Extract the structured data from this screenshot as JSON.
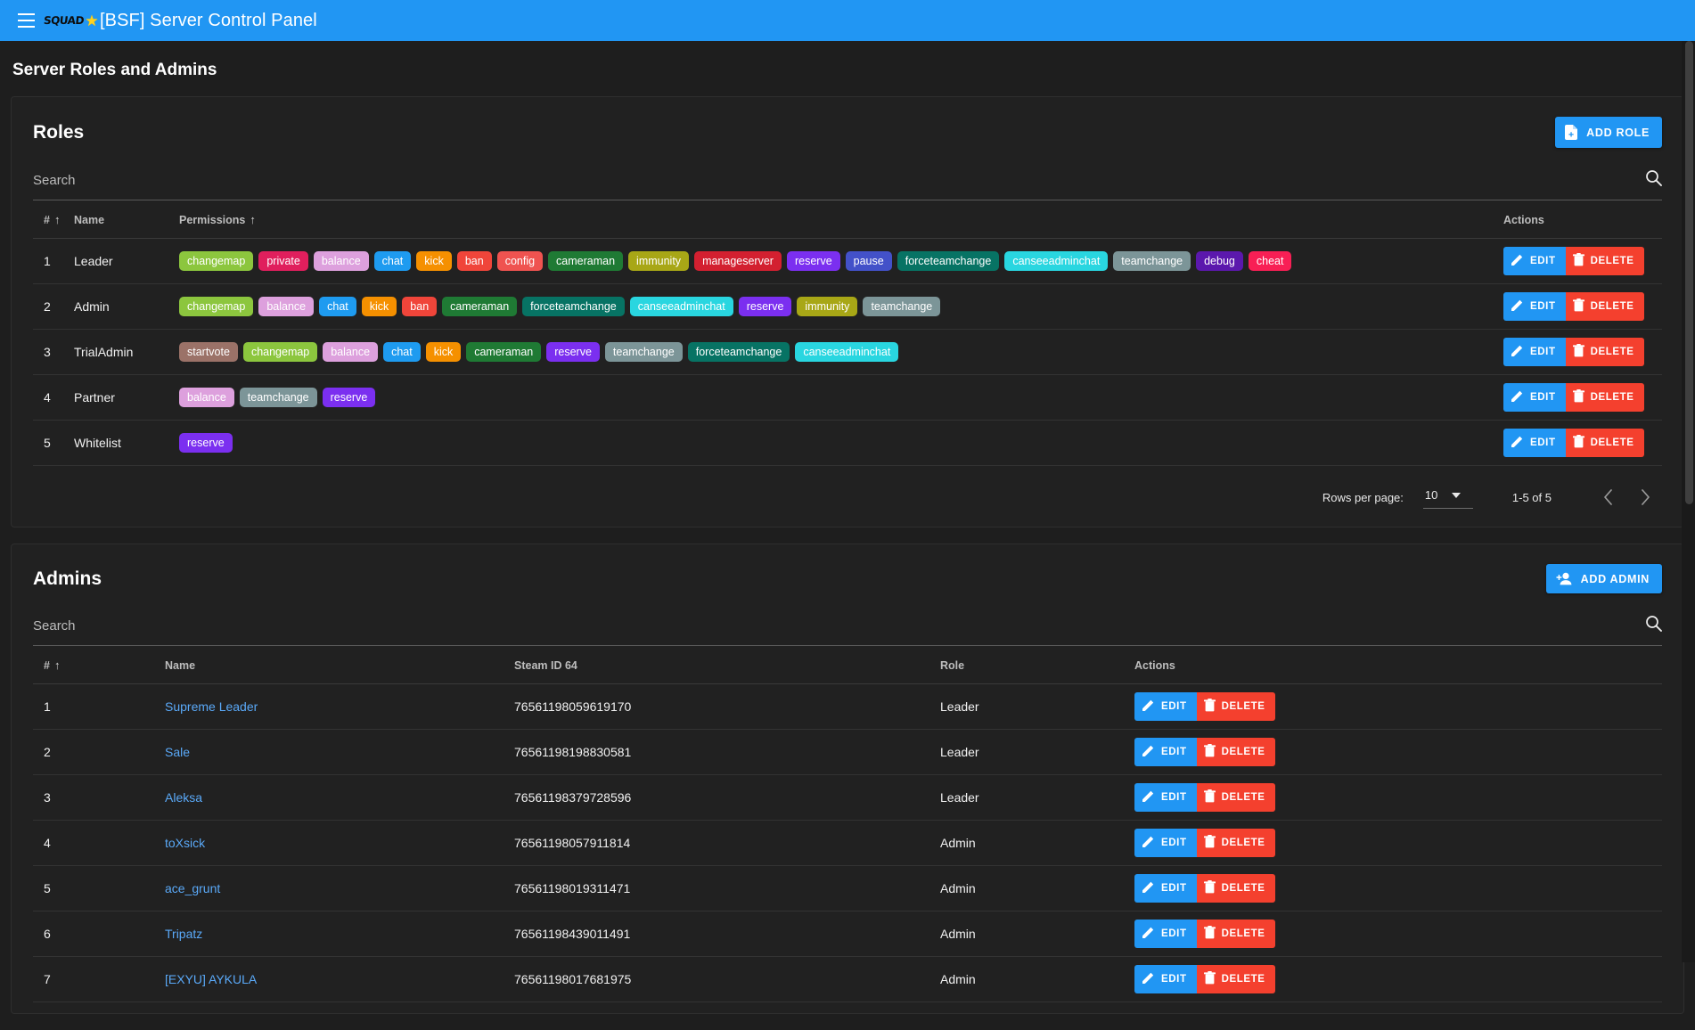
{
  "appbar": {
    "menu_icon": "hamburger-menu-icon",
    "logo_text": "SQUAD",
    "logo_star": "★",
    "title": "[BSF] Server Control Panel",
    "accent_color": "#2196f3"
  },
  "page": {
    "title": "Server Roles and Admins"
  },
  "roles_section": {
    "title": "Roles",
    "add_button": {
      "label": "ADD ROLE",
      "icon": "file-add-icon"
    },
    "search": {
      "placeholder": "Search",
      "icon": "search-icon"
    },
    "columns": [
      "#",
      "Name",
      "Permissions",
      "Actions"
    ],
    "sorted_columns": [
      "#",
      "Permissions"
    ],
    "row_actions": {
      "edit": "EDIT",
      "delete": "DELETE",
      "edit_icon": "pencil-icon",
      "delete_icon": "trash-icon"
    },
    "rows": [
      {
        "num": "1",
        "name": "Leader",
        "permissions": [
          {
            "label": "changemap",
            "color": "#8cc63e"
          },
          {
            "label": "private",
            "color": "#e01f5d"
          },
          {
            "label": "balance",
            "color": "#dda0dd"
          },
          {
            "label": "chat",
            "color": "#1e9bf0"
          },
          {
            "label": "kick",
            "color": "#f59000"
          },
          {
            "label": "ban",
            "color": "#f0453a"
          },
          {
            "label": "config",
            "color": "#ef5350"
          },
          {
            "label": "cameraman",
            "color": "#1f7a34"
          },
          {
            "label": "immunity",
            "color": "#a8a716"
          },
          {
            "label": "manageserver",
            "color": "#d32030"
          },
          {
            "label": "reserve",
            "color": "#7b2ff0"
          },
          {
            "label": "pause",
            "color": "#4351c9"
          },
          {
            "label": "forceteamchange",
            "color": "#077364"
          },
          {
            "label": "canseeadminchat",
            "color": "#29d6e0"
          },
          {
            "label": "teamchange",
            "color": "#7c9598"
          },
          {
            "label": "debug",
            "color": "#5b18ad"
          },
          {
            "label": "cheat",
            "color": "#f81f55"
          }
        ]
      },
      {
        "num": "2",
        "name": "Admin",
        "permissions": [
          {
            "label": "changemap",
            "color": "#8cc63e"
          },
          {
            "label": "balance",
            "color": "#dda0dd"
          },
          {
            "label": "chat",
            "color": "#1e9bf0"
          },
          {
            "label": "kick",
            "color": "#f59000"
          },
          {
            "label": "ban",
            "color": "#f0453a"
          },
          {
            "label": "cameraman",
            "color": "#1f7a34"
          },
          {
            "label": "forceteamchange",
            "color": "#077364"
          },
          {
            "label": "canseeadminchat",
            "color": "#29d6e0"
          },
          {
            "label": "reserve",
            "color": "#7b2ff0"
          },
          {
            "label": "immunity",
            "color": "#a8a716"
          },
          {
            "label": "teamchange",
            "color": "#7c9598"
          }
        ]
      },
      {
        "num": "3",
        "name": "TrialAdmin",
        "permissions": [
          {
            "label": "startvote",
            "color": "#9b7268"
          },
          {
            "label": "changemap",
            "color": "#8cc63e"
          },
          {
            "label": "balance",
            "color": "#dda0dd"
          },
          {
            "label": "chat",
            "color": "#1e9bf0"
          },
          {
            "label": "kick",
            "color": "#f59000"
          },
          {
            "label": "cameraman",
            "color": "#1f7a34"
          },
          {
            "label": "reserve",
            "color": "#7b2ff0"
          },
          {
            "label": "teamchange",
            "color": "#7c9598"
          },
          {
            "label": "forceteamchange",
            "color": "#077364"
          },
          {
            "label": "canseeadminchat",
            "color": "#29d6e0"
          }
        ]
      },
      {
        "num": "4",
        "name": "Partner",
        "permissions": [
          {
            "label": "balance",
            "color": "#dda0dd"
          },
          {
            "label": "teamchange",
            "color": "#7c9598"
          },
          {
            "label": "reserve",
            "color": "#7b2ff0"
          }
        ]
      },
      {
        "num": "5",
        "name": "Whitelist",
        "permissions": [
          {
            "label": "reserve",
            "color": "#7b2ff0"
          }
        ]
      }
    ],
    "pagination": {
      "rows_per_page_label": "Rows per page:",
      "rows_per_page_value": "10",
      "range": "1-5 of 5",
      "prev_icon": "chevron-left-icon",
      "next_icon": "chevron-right-icon"
    }
  },
  "admins_section": {
    "title": "Admins",
    "add_button": {
      "label": "ADD ADMIN",
      "icon": "person-add-icon"
    },
    "search": {
      "placeholder": "Search",
      "icon": "search-icon"
    },
    "columns": [
      "#",
      "Name",
      "Steam ID 64",
      "Role",
      "Actions"
    ],
    "sorted_columns": [
      "#"
    ],
    "row_actions": {
      "edit": "EDIT",
      "delete": "DELETE",
      "edit_icon": "pencil-icon",
      "delete_icon": "trash-icon"
    },
    "rows": [
      {
        "num": "1",
        "name": "Supreme Leader",
        "steam_id": "76561198059619170",
        "role": "Leader"
      },
      {
        "num": "2",
        "name": "Sale",
        "steam_id": "76561198198830581",
        "role": "Leader"
      },
      {
        "num": "3",
        "name": "Aleksa",
        "steam_id": "76561198379728596",
        "role": "Leader"
      },
      {
        "num": "4",
        "name": "toXsick",
        "steam_id": "76561198057911814",
        "role": "Admin"
      },
      {
        "num": "5",
        "name": "ace_grunt",
        "steam_id": "76561198019311471",
        "role": "Admin"
      },
      {
        "num": "6",
        "name": "Tripatz",
        "steam_id": "76561198439011491",
        "role": "Admin"
      },
      {
        "num": "7",
        "name": "[EXYU] AYKULA",
        "steam_id": "76561198017681975",
        "role": "Admin"
      }
    ]
  }
}
